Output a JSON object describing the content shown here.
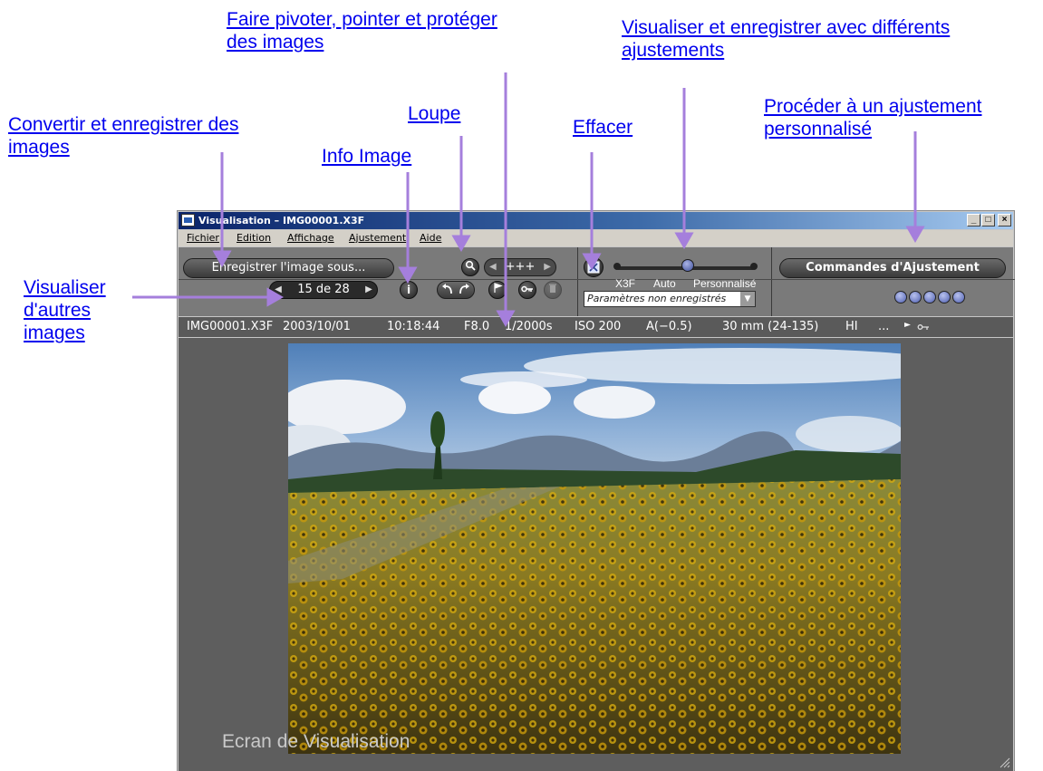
{
  "callouts": {
    "rotate_flag_protect": [
      "Faire pivoter, pointer et protéger",
      "des images"
    ],
    "view_save_adjust": [
      "Visualiser et enregistrer avec différents",
      "ajustements"
    ],
    "convert_save": [
      "Convertir et enregistrer des",
      "images"
    ],
    "loupe": "Loupe",
    "effacer": "Effacer",
    "custom_adjust": [
      "Procéder à un ajustement",
      "personnalisé"
    ],
    "info_image": "Info Image",
    "other_images": [
      "Visualiser",
      "d'autres",
      "images"
    ]
  },
  "window": {
    "title": "Visualisation – IMG00001.X3F",
    "minimize": "_",
    "maximize": "□",
    "close": "×"
  },
  "menu": [
    "Fichier",
    "Edition",
    "Affichage",
    "Ajustement",
    "Aide"
  ],
  "toolbar": {
    "save_as": "Enregistrer l'image sous...",
    "adjust_controls": "Commandes d'Ajustement",
    "zoom_value": "+++",
    "nav_position": "15 de 28",
    "info_symbol": "i",
    "settings_status": "Paramètres non enregistrés",
    "slider_labels": [
      "X3F",
      "Auto",
      "Personnalisé"
    ],
    "slider_selected": "Auto"
  },
  "info_bar": {
    "filename": "IMG00001.X3F",
    "date": "2003/10/01",
    "time": "10:18:44",
    "aperture": "F8.0",
    "shutter": "1/2000s",
    "iso": "ISO 200",
    "exposure": "A(−0.5)",
    "focal": "30 mm (24-135)",
    "quality": "HI",
    "more": "..."
  },
  "viewer": {
    "label": "Ecran de Visualisation"
  },
  "colors": {
    "callout_text": "#0000ee",
    "arrow": "#a57fdc",
    "titlebar_start": "#0a246a",
    "toolbar": "#7a7a7a"
  },
  "icons": [
    "magnifier-icon",
    "rotate-left-icon",
    "rotate-right-icon",
    "flag-icon",
    "key-icon",
    "trash-icon",
    "erase-icon",
    "info-icon"
  ]
}
